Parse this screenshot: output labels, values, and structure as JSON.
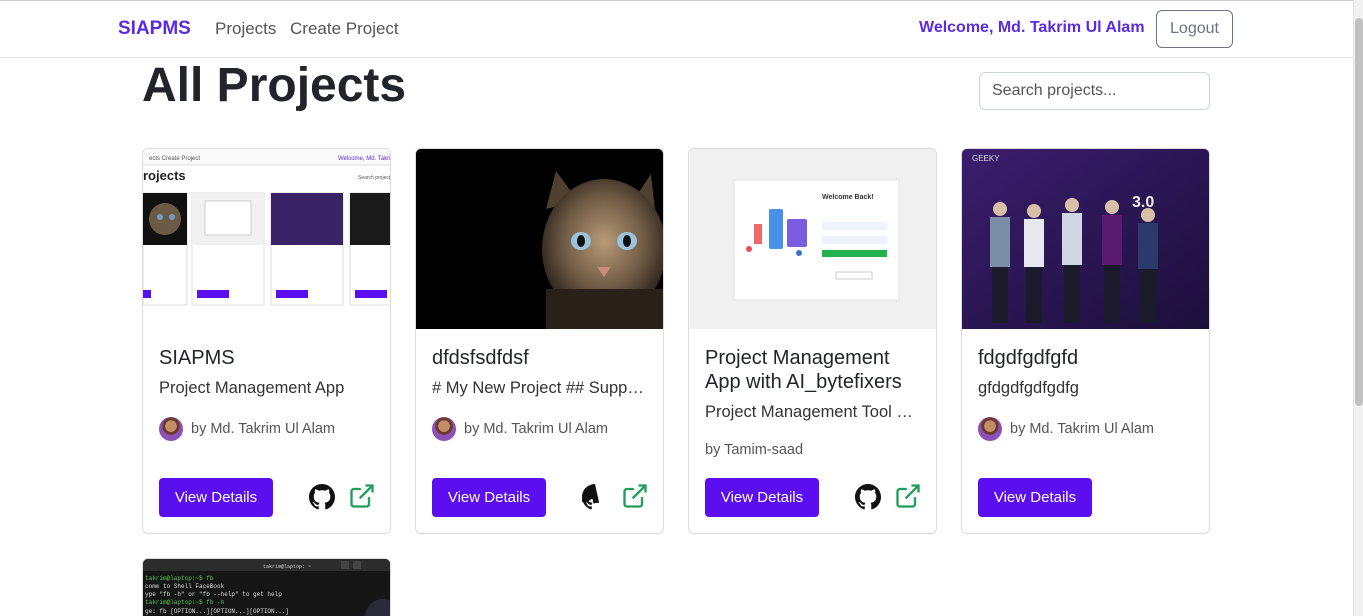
{
  "navbar": {
    "brand": "SIAPMS",
    "links": [
      "Projects",
      "Create Project"
    ],
    "welcome": "Welcome, Md. Takrim Ul Alam",
    "logout": "Logout"
  },
  "page": {
    "title": "All Projects",
    "search_placeholder": "Search projects..."
  },
  "projects": [
    {
      "title": "SIAPMS",
      "description": "Project Management App",
      "author": "by Md. Takrim Ul Alam",
      "button": "View Details",
      "has_github": true,
      "has_link": true,
      "image": "app-screenshot"
    },
    {
      "title": "dfdsfsdfdsf",
      "description": "# My New Project ## Supp…",
      "author": "by Md. Takrim Ul Alam",
      "button": "View Details",
      "has_github": true,
      "has_link": true,
      "image": "cat-photo"
    },
    {
      "title": "Project Management App with AI_bytefixers",
      "description": "Project Management Tool …",
      "author": "by Tamim-saad",
      "button": "View Details",
      "has_github": true,
      "has_link": true,
      "image": "login-screenshot"
    },
    {
      "title": "fdgdfgdfgfd",
      "description": "gfdgdfgdfgdfg",
      "author": "by Md. Takrim Ul Alam",
      "button": "View Details",
      "has_github": false,
      "has_link": false,
      "image": "group-photo"
    },
    {
      "title": "",
      "description": "",
      "author": "",
      "button": "",
      "image": "terminal-screenshot"
    }
  ],
  "colors": {
    "accent": "#5b2be0",
    "button": "#5b0ef0",
    "link_icon": "#1e9e5a"
  }
}
